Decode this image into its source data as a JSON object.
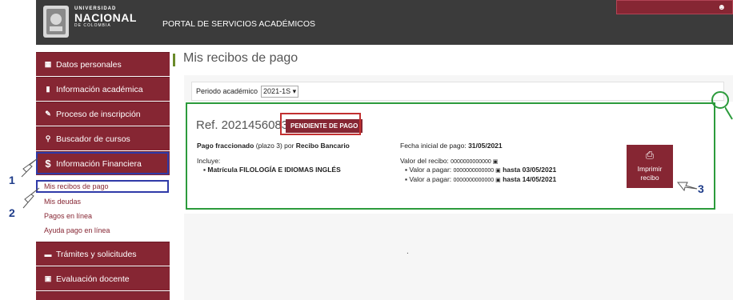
{
  "header": {
    "uni_l1": "UNIVERSIDAD",
    "uni_l2": "NACIONAL",
    "uni_l3": "DE COLOMBIA",
    "portal": "PORTAL DE SERVICIOS ACADÉMICOS"
  },
  "sidebar": {
    "items": [
      {
        "label": "Datos personales",
        "icon": "id-card-icon"
      },
      {
        "label": "Información académica",
        "icon": "book-icon"
      },
      {
        "label": "Proceso de inscripción",
        "icon": "edit-icon"
      },
      {
        "label": "Buscador de cursos",
        "icon": "search-icon"
      },
      {
        "label": "Información Financiera",
        "icon": "dollar-icon"
      },
      {
        "label": "Trámites y solicitudes",
        "icon": "folder-icon"
      },
      {
        "label": "Evaluación docente",
        "icon": "chat-icon"
      }
    ],
    "submenu": [
      "Mis recibos de pago",
      "Mis deudas",
      "Pagos en línea",
      "Ayuda pago en línea"
    ]
  },
  "annotations": {
    "n1": "1",
    "n2": "2",
    "n3": "3"
  },
  "main": {
    "title": "Mis recibos de pago",
    "periodo_label": "Periodo académico",
    "periodo_value": "2021-1S",
    "ref": "Ref. 2021456083",
    "status": "PENDIENTE DE PAGO",
    "pago_fraccionado": "Pago fraccionado",
    "plazo": "(plazo 3) por",
    "recibo_bancario": "Recibo Bancario",
    "incluye": "Incluye:",
    "incluye_item": "▪ Matrícula FILOLOGÍA E IDIOMAS INGLÉS",
    "fecha_label": "Fecha inicial de pago:",
    "fecha_value": "31/05/2021",
    "valor_label": "Valor del recibo:",
    "valor_value": "0000000000000 ▣",
    "valor1": "▪ Valor a pagar:",
    "valor1_amount": "0000000000000 ▣",
    "hasta": "hasta",
    "date1": "03/05/2021",
    "valor2": "▪ Valor a pagar:",
    "valor2_amount": "0000000000000 ▣",
    "date2": "14/05/2021",
    "print_l1": "Imprimir",
    "print_l2": "recibo",
    "dot": "."
  },
  "colors": {
    "brand": "#862633",
    "topbar": "#3b3b3b",
    "highlight_green": "#2c9b3c",
    "highlight_blue": "#2f3aa8",
    "highlight_red": "#c23030"
  }
}
